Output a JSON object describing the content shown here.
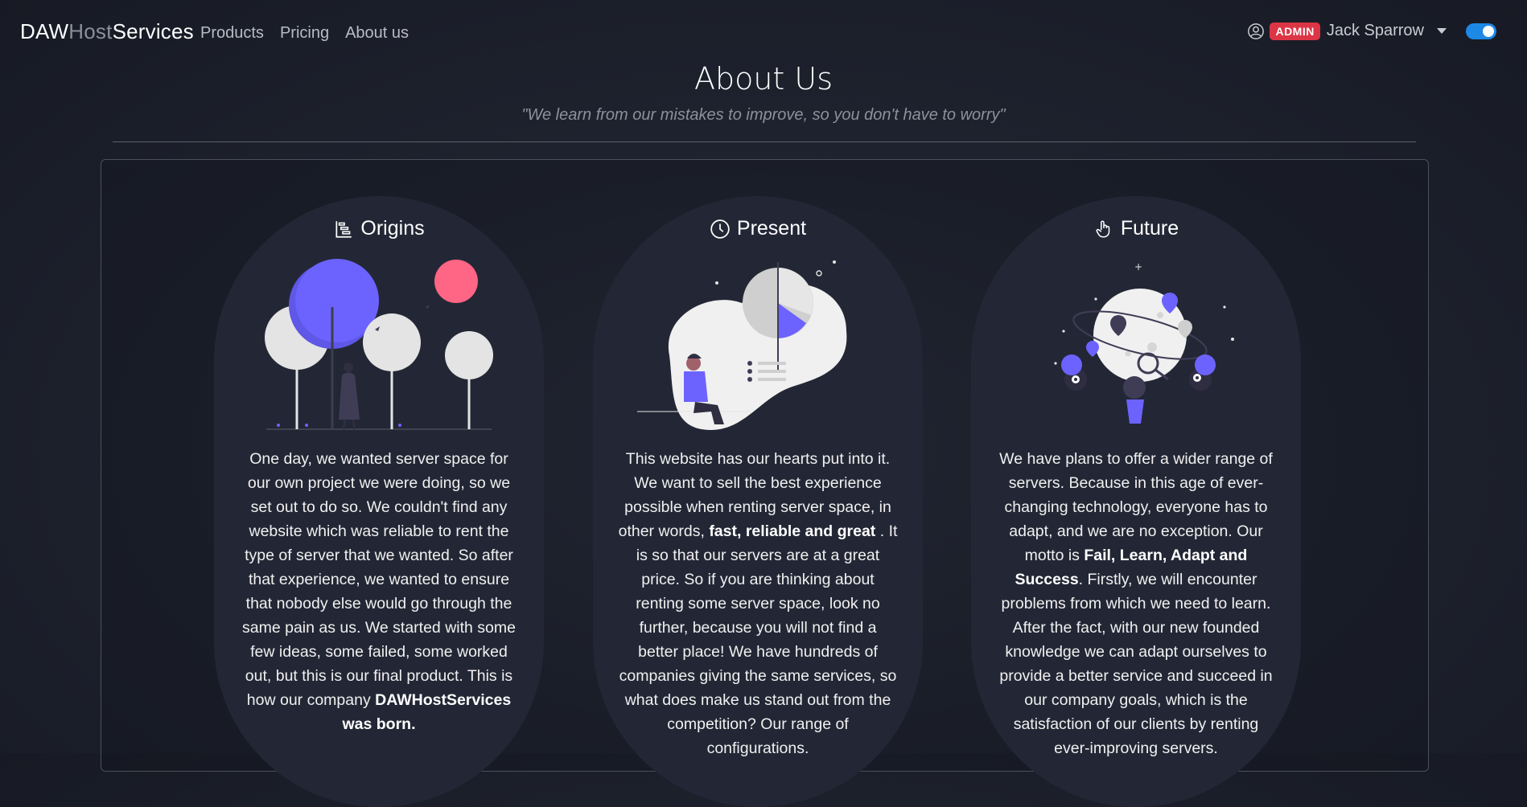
{
  "navbar": {
    "brand": {
      "part1": "DAW",
      "part2": "Host",
      "part3": "Services"
    },
    "links": [
      {
        "label": "Products"
      },
      {
        "label": "Pricing"
      },
      {
        "label": "About us"
      }
    ],
    "user": {
      "badge": "ADMIN",
      "name": "Jack Sparrow"
    },
    "theme_toggle": {
      "state": "on"
    }
  },
  "page": {
    "title": "About Us",
    "quote": "\"We learn from our mistakes to improve, so you don't have to worry\""
  },
  "columns": [
    {
      "title": "Origins",
      "icon": "timeline-icon",
      "text_before": "One day, we wanted server space for our own project we were doing, so we set out to do so. We couldn't find any website which was reliable to rent the type of server that we wanted. So after that experience, we wanted to ensure that nobody else would go through the same pain as us. We started with some few ideas, some failed, some worked out, but this is our final product. This is how our company ",
      "text_bold": "DAWHostServices was born.",
      "text_after": ""
    },
    {
      "title": "Present",
      "icon": "clock-icon",
      "text_before": "This website has our hearts put into it. We want to sell the best experience possible when renting server space, in other words, ",
      "text_bold": "fast, reliable and great",
      "text_after": " . It is so that our servers are at a great price. So if you are thinking about renting some server space, look no further, because you will not find a better place! We have hundreds of companies giving the same services, so what does make us stand out from the competition? Our range of configurations."
    },
    {
      "title": "Future",
      "icon": "pointer-hand-icon",
      "text_before": "We have plans to offer a wider range of servers. Because in this age of ever-changing technology, everyone has to adapt, and we are no exception. Our motto is ",
      "text_bold": "Fail, Learn, Adapt and Success",
      "text_after": ". Firstly, we will encounter problems from which we need to learn. After the fact, with our new founded knowledge we can adapt ourselves to provide a better service and succeed in our company goals, which is the satisfaction of our clients by renting ever-improving servers."
    }
  ],
  "colors": {
    "accent": "#6c63ff",
    "badge": "#dc3545",
    "toggle": "#1e88e5",
    "pink": "#ff6584"
  }
}
